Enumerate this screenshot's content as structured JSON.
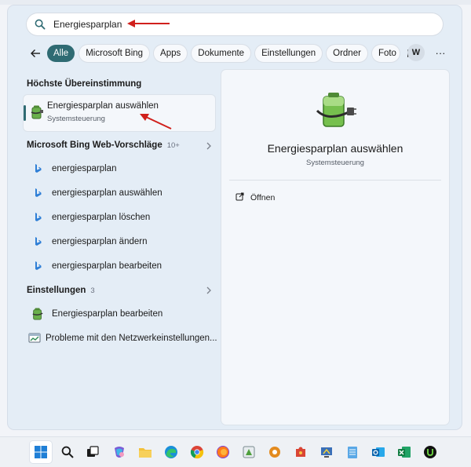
{
  "search": {
    "value": "Energiesparplan",
    "placeholder": ""
  },
  "filters": {
    "chips": [
      "Alle",
      "Microsoft Bing",
      "Apps",
      "Dokumente",
      "Einstellungen",
      "Ordner",
      "Foto"
    ],
    "active_index": 0,
    "avatar_initial": "W",
    "more_label": "···"
  },
  "best_match": {
    "heading": "Höchste Übereinstimmung",
    "title": "Energiesparplan auswählen",
    "subtitle": "Systemsteuerung",
    "icon": "power-plan-battery-icon"
  },
  "bing": {
    "heading": "Microsoft Bing Web-Vorschläge",
    "count": "10+",
    "items": [
      "energiesparplan",
      "energiesparplan auswählen",
      "energiesparplan löschen",
      "energiesparplan ändern",
      "energiesparplan bearbeiten"
    ],
    "icon": "bing-icon"
  },
  "settings": {
    "heading": "Einstellungen",
    "count": "3",
    "items": [
      {
        "label": "Energiesparplan bearbeiten",
        "icon": "power-plan-battery-icon"
      },
      {
        "label": "Probleme mit den Netzwerkeinstellungen...",
        "icon": "network-troubleshoot-icon"
      }
    ]
  },
  "detail": {
    "title": "Energiesparplan auswählen",
    "subtitle": "Systemsteuerung",
    "action_open": "Öffnen"
  },
  "taskbar": {
    "items": [
      "start-icon",
      "search-icon",
      "task-view-icon",
      "copilot-icon",
      "file-explorer-icon",
      "edge-icon",
      "chrome-icon",
      "firefox-icon",
      "app-icon",
      "settings-gear-app-icon",
      "puzzle-app-icon",
      "control-panel-icon",
      "notepad-icon",
      "outlook-icon",
      "excel-icon",
      "upwork-icon"
    ]
  },
  "colors": {
    "accent": "#2f6b73",
    "annotation_arrow": "#d0201c",
    "bing_blue": "#2f7fd6"
  }
}
